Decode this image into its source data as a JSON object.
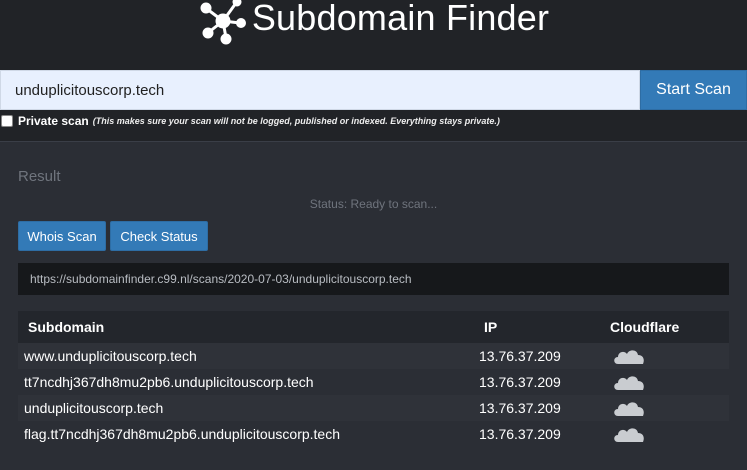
{
  "header": {
    "title": "Subdomain Finder",
    "logo_icon": "network-nodes-icon"
  },
  "search": {
    "value": "unduplicitouscorp.tech",
    "button_label": "Start Scan"
  },
  "private_scan": {
    "checked": false,
    "label": "Private scan",
    "note": "(This makes sure your scan will not be logged, published or indexed. Everything stays private.)"
  },
  "result": {
    "label": "Result",
    "status": "Status: Ready to scan...",
    "whois_label": "Whois Scan",
    "check_status_label": "Check Status",
    "url": "https://subdomainfinder.c99.nl/scans/2020-07-03/unduplicitouscorp.tech"
  },
  "table": {
    "headers": [
      "Subdomain",
      "IP",
      "Cloudflare"
    ],
    "rows": [
      {
        "subdomain": "www.unduplicitouscorp.tech",
        "ip": "13.76.37.209",
        "cloudflare_icon": "cloud-icon"
      },
      {
        "subdomain": "tt7ncdhj367dh8mu2pb6.unduplicitouscorp.tech",
        "ip": "13.76.37.209",
        "cloudflare_icon": "cloud-icon"
      },
      {
        "subdomain": "unduplicitouscorp.tech",
        "ip": "13.76.37.209",
        "cloudflare_icon": "cloud-icon"
      },
      {
        "subdomain": "flag.tt7ncdhj367dh8mu2pb6.unduplicitouscorp.tech",
        "ip": "13.76.37.209",
        "cloudflare_icon": "cloud-icon"
      }
    ]
  },
  "colors": {
    "background": "#212327",
    "panel": "#2b2e35",
    "accent": "#337ab7",
    "input_bg": "#e8f0fe"
  }
}
